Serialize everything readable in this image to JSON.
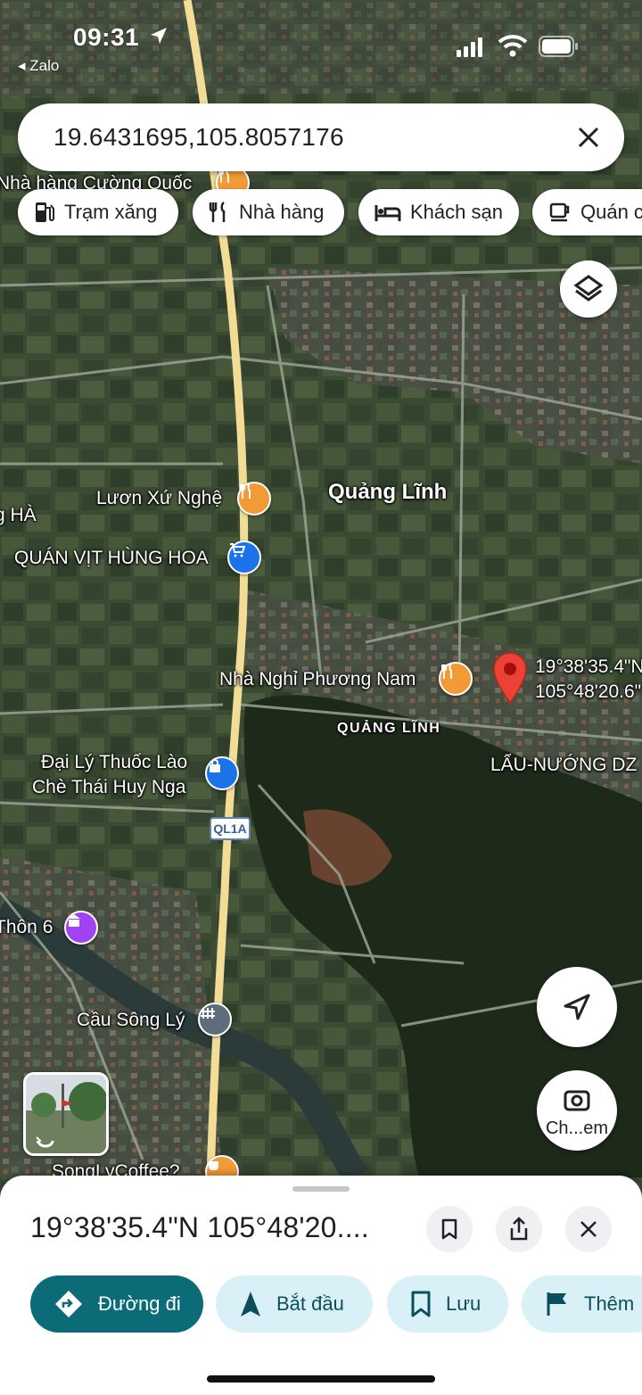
{
  "status_bar": {
    "time": "09:31",
    "back_app": "◂ Zalo"
  },
  "search": {
    "query": "19.6431695,105.8057176"
  },
  "chips": [
    {
      "label": "Trạm xăng",
      "icon": "gas-station-icon"
    },
    {
      "label": "Nhà hàng",
      "icon": "restaurant-icon"
    },
    {
      "label": "Khách sạn",
      "icon": "hotel-icon"
    },
    {
      "label": "Quán c",
      "icon": "coffee-icon"
    }
  ],
  "map": {
    "labels": {
      "restaurant_top": "Nhà hàng Cường Quốc",
      "luon": "Lươn Xứ Nghệ",
      "ha": "g HÀ",
      "quan_vit": "QUÁN VỊT HÙNG HOA",
      "village": "Quảng Lĩnh",
      "nha_nghi": "Nhà Nghỉ Phương Nam",
      "quang_linh_small": "QUẢNG LĨNH",
      "lau_nuong": "LẨU-NƯỚNG DZ",
      "dai_ly_1": "Đại Lý Thuốc Lào",
      "dai_ly_2": "Chè Thái Huy Nga",
      "thon6": "Thôn 6",
      "cau_song_ly": "Cầu Sông Lý",
      "coffee": "SongLyCoffee?",
      "pin_lat": "19°38'35.4\"N",
      "pin_lng": "105°48'20.6\"",
      "road_shield": "QL1A"
    },
    "colors": {
      "road": "#f3dc96",
      "pin": "#ea4335",
      "poi_food": "#f29a36",
      "poi_shop": "#1a73e8",
      "poi_purple": "#a142f4",
      "poi_gray": "#5f6c7b"
    }
  },
  "camera_button": {
    "label": "Ch...em"
  },
  "sheet": {
    "title": "19°38'35.4\"N 105°48'20....",
    "actions": [
      {
        "label": "Đường đi",
        "style": "primary"
      },
      {
        "label": "Bắt đầu",
        "style": "secondary"
      },
      {
        "label": "Lưu",
        "style": "secondary"
      },
      {
        "label": "Thêm",
        "style": "secondary"
      }
    ],
    "colors": {
      "primary_bg": "#0b6b77",
      "secondary_bg": "#d9f1f6",
      "secondary_text": "#0b4f5a"
    }
  }
}
